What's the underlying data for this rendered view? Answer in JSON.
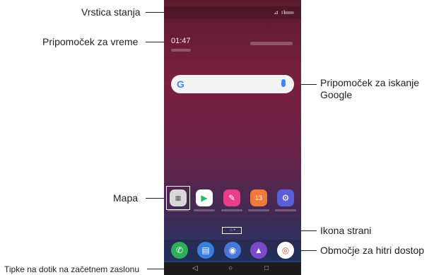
{
  "callouts": {
    "status_bar": "Vrstica stanja",
    "weather_widget": "Pripomoček za vreme",
    "google_widget_line1": "Pripomoček za iskanje",
    "google_widget_line2": "Google",
    "folder": "Mapa",
    "page_icon": "Ikona strani",
    "quick_access": "Območje za hitri dostop",
    "home_touch_buttons": "Tipke na dotik na začetnem zaslonu"
  },
  "phone": {
    "weather_time": "01:47",
    "google_logo": "G",
    "nav": {
      "back": "◁",
      "home": "○",
      "recent": "□"
    }
  },
  "colors": {
    "accent_google": "#4285f4",
    "callout_line": "#222222"
  }
}
